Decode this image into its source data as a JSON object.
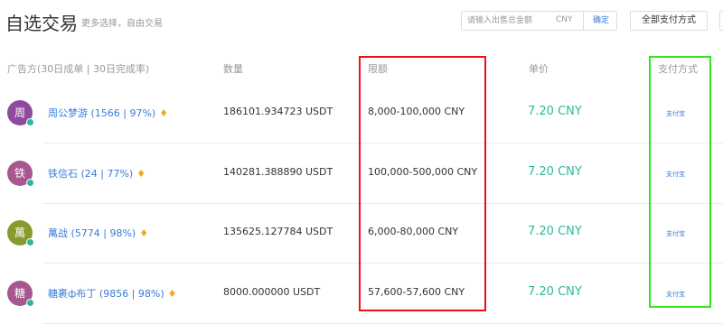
{
  "header": {
    "title": "自选交易",
    "subtitle": "更多选择，自由交易",
    "amount_placeholder": "请输入出售总金额",
    "currency": "CNY",
    "confirm": "确定",
    "payment_filter": "全部支付方式"
  },
  "columns": {
    "advertiser": "广告方(30日成单 | 30日完成率)",
    "quantity": "数量",
    "limit": "限额",
    "price": "单价",
    "payment": "支付方式"
  },
  "rows": [
    {
      "avatar": "周",
      "avatar_color": "#8e4a9e",
      "name": "周公梦游 (1566 | 97%)",
      "quantity": "186101.934723 USDT",
      "limit": "8,000-100,000 CNY",
      "price": "7.20 CNY",
      "payment": "支付宝"
    },
    {
      "avatar": "铁",
      "avatar_color": "#a7578f",
      "name": "铁信石 (24 | 77%)",
      "quantity": "140281.388890 USDT",
      "limit": "100,000-500,000 CNY",
      "price": "7.20 CNY",
      "payment": "支付宝"
    },
    {
      "avatar": "萬",
      "avatar_color": "#8b9a2e",
      "name": "萬战 (5774 | 98%)",
      "quantity": "135625.127784 USDT",
      "limit": "6,000-80,000 CNY",
      "price": "7.20 CNY",
      "payment": "支付宝"
    },
    {
      "avatar": "糖",
      "avatar_color": "#a7578f",
      "name": "糖裹ф布丁 (9856 | 98%)",
      "quantity": "8000.000000 USDT",
      "limit": "57,600-57,600 CNY",
      "price": "7.20 CNY",
      "payment": "支付宝"
    }
  ],
  "colors": {
    "accent_blue": "#3a7bd5",
    "price_green": "#2eb89a",
    "highlight_red": "#e8101a",
    "highlight_green": "#2ee81a"
  }
}
